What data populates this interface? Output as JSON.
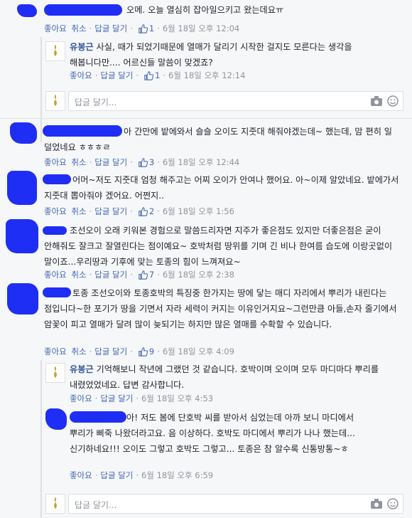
{
  "labels": {
    "like": "좋아요",
    "cancel": "취소",
    "reply": "답글 달기",
    "reply_placeholder": "답글 달기..."
  },
  "comments": [
    {
      "id": "c1",
      "text": "오메. 오늘 열심히 잡아일으키고 왔는데요ㅠ",
      "likes": "1",
      "time": "6월 18일 오후 12:04",
      "liked": true
    },
    {
      "id": "r1",
      "name": "유봉근",
      "text": "사실, 때가 되었기때문에 열매가 달리기 시작한 걸지도 모른다는 생각을 해봅니다만.... 어르신들 말씀이 맞겠죠?",
      "likes": "1",
      "time": "6월 18일 오후 12:14",
      "liked": false
    },
    {
      "id": "c2",
      "text": "아 간만에 밭에와서 슬슬 오이도 지줏대 해줘야겠는데~ 했는데, 맘 편히 일 덜었네요 ㅎㅎㅎㄹ",
      "likes": "3",
      "time": "6월 18일 오후 12:44",
      "liked": true
    },
    {
      "id": "c3",
      "text": "어머~저도 지줏대 엄청 해주고는 어찌 오이가 안여나 했어요. 아~이제 알았네요. 밭에가서 지줏대 뽑아줘야 겠어요. 어쩐지..",
      "likes": "2",
      "time": "6월 18일 오후 1:56",
      "liked": true
    },
    {
      "id": "c4",
      "text": "조선오이 오래 키워본 경험으로 말씀드리자면 지주가 좋은점도 있지만 더좋은점은 굳이 안해줘도 잘크고 잘열린다는 점이예요~ 호박처럼 땅위를 기며 긴 비나 한여름 습도에 이랑곳없이 말이죠...우리땅과 기후에 맞는 토종의 힘이 느껴져요~",
      "likes": "7",
      "time": "6월 18일 오후 2:38",
      "liked": true
    },
    {
      "id": "c5",
      "text": "토종 조선오이와 토종호박의 특징중 한가지는 땅에 닿는 매디 자리에서 뿌리가 내린다는 점입니다~한 포기가 땅을 기면서 자라 세력이 커지는 이유인거지요~그런만큼 아들,손자 줄기에서 암꽃이 피고 열매가 달려 많이 늦되기는 하지만 많은 열매를 수확할 수 있습니다.",
      "likes": "9",
      "time": "6월 18일 오후 4:09",
      "liked": true
    },
    {
      "id": "r2",
      "name": "유봉근",
      "text": "기억해보니 작년에 그랬던 것 같습니다. 호박이며 오이며 모두 마디마다 뿌리를 내렸었었네요. 답변 감사합니다.",
      "time": "6월 18일 오후 4:53"
    },
    {
      "id": "r3",
      "text": "아! 저도 봄에 단호박 씨를 받아서 심었는데 아까 보니 마디에서 뿌리가 삐죽 나왔더라고요. 음 이상하다. 호박도 마디에서 뿌리가 나나 했는데... 신기하네요!!! 오이도 그렇고 호박도 그렇고... 토종은 참 알수록 신통방통~ㅎ",
      "time": "6월 18일 오후 6:59"
    }
  ]
}
